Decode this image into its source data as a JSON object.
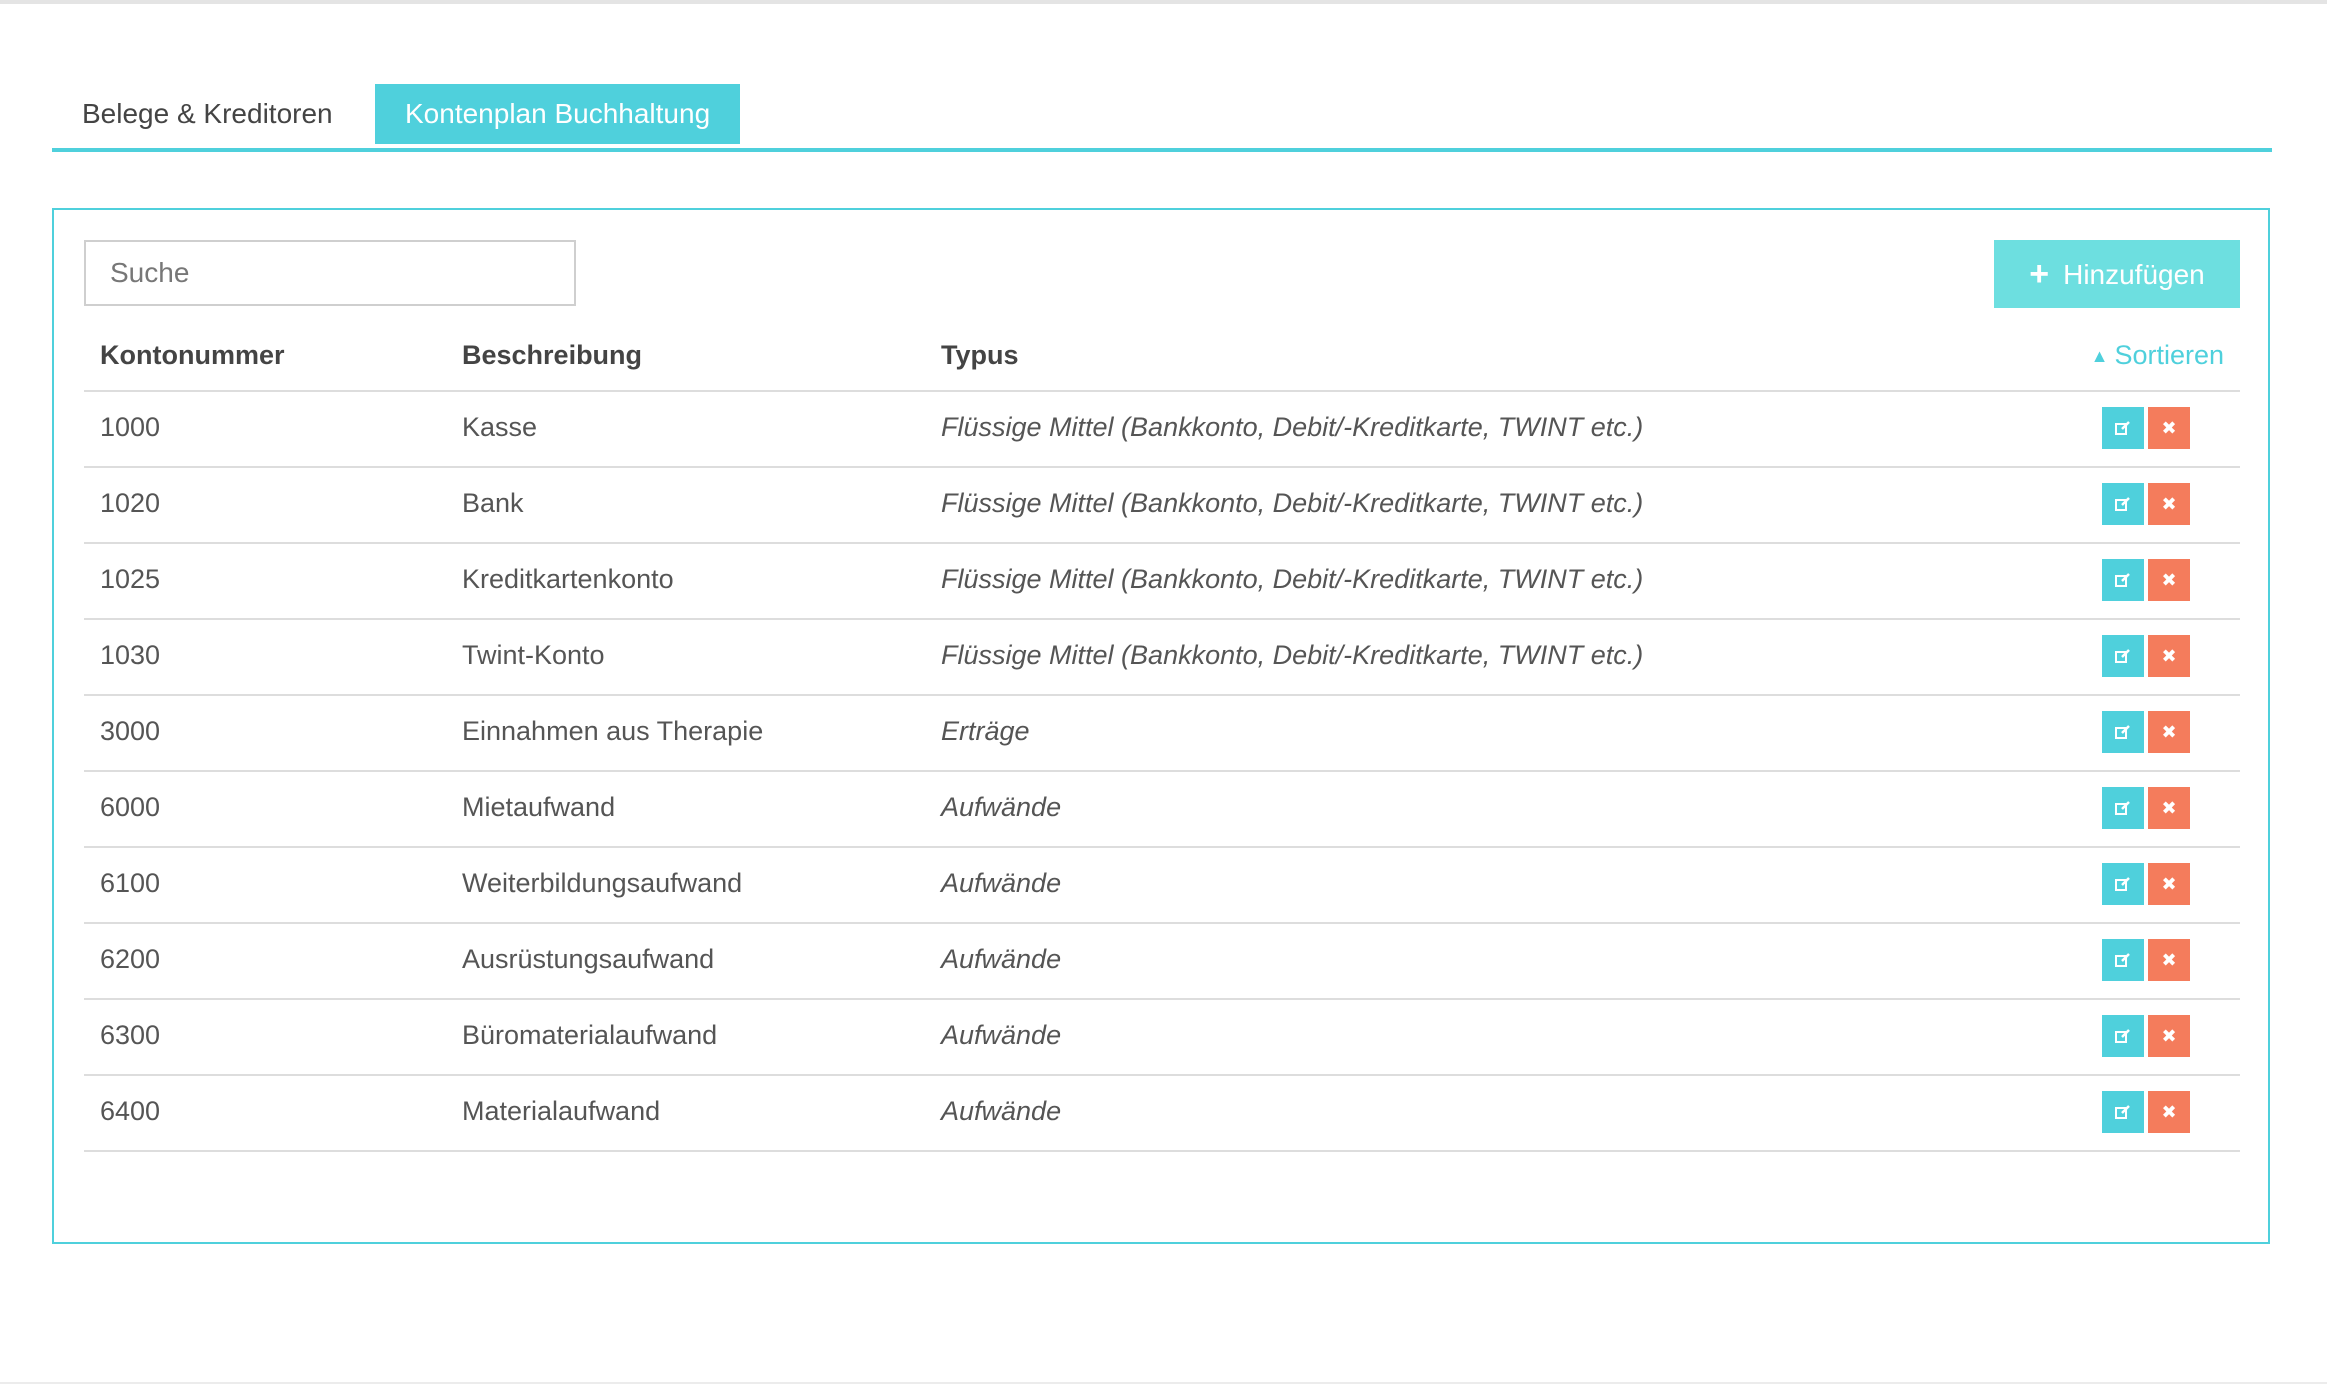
{
  "tabs": [
    {
      "label": "Belege & Kreditoren",
      "active": false
    },
    {
      "label": "Kontenplan Buchhaltung",
      "active": true
    }
  ],
  "search": {
    "placeholder": "Suche",
    "value": ""
  },
  "toolbar": {
    "add_label": "Hinzufügen",
    "add_icon": "plus-icon"
  },
  "table": {
    "columns": [
      "Kontonummer",
      "Beschreibung",
      "Typus"
    ],
    "sort_label": "Sortieren",
    "rows": [
      {
        "number": "1000",
        "description": "Kasse",
        "type": "Flüssige Mittel (Bankkonto, Debit/-Kreditkarte, TWINT etc.)"
      },
      {
        "number": "1020",
        "description": "Bank",
        "type": "Flüssige Mittel (Bankkonto, Debit/-Kreditkarte, TWINT etc.)"
      },
      {
        "number": "1025",
        "description": "Kreditkartenkonto",
        "type": "Flüssige Mittel (Bankkonto, Debit/-Kreditkarte, TWINT etc.)"
      },
      {
        "number": "1030",
        "description": "Twint-Konto",
        "type": "Flüssige Mittel (Bankkonto, Debit/-Kreditkarte, TWINT etc.)"
      },
      {
        "number": "3000",
        "description": "Einnahmen aus Therapie",
        "type": "Erträge"
      },
      {
        "number": "6000",
        "description": "Mietaufwand",
        "type": "Aufwände"
      },
      {
        "number": "6100",
        "description": "Weiterbildungsaufwand",
        "type": "Aufwände"
      },
      {
        "number": "6200",
        "description": "Ausrüstungsaufwand",
        "type": "Aufwände"
      },
      {
        "number": "6300",
        "description": "Büromaterialaufwand",
        "type": "Aufwände"
      },
      {
        "number": "6400",
        "description": "Materialaufwand",
        "type": "Aufwände"
      }
    ]
  },
  "colors": {
    "accent": "#4fd0dc",
    "add_button": "#6ddfe0",
    "delete": "#f47c5c",
    "text": "#555555"
  }
}
